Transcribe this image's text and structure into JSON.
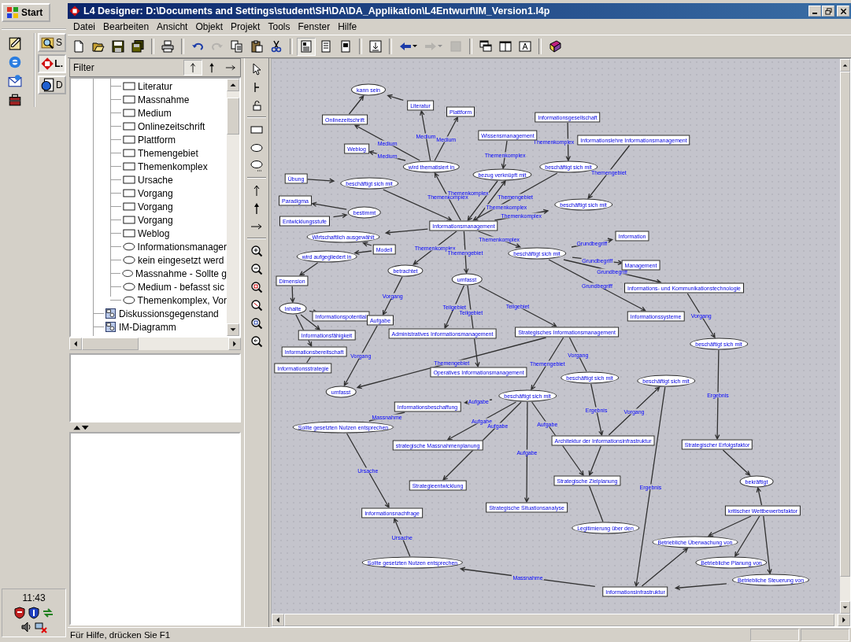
{
  "taskbar": {
    "start": "Start",
    "tasks": [
      {
        "label": "S",
        "selected": false
      },
      {
        "label": "L.",
        "selected": true
      },
      {
        "label": "D",
        "selected": false
      }
    ],
    "clock": "11:43"
  },
  "window": {
    "title": "L4 Designer: D:\\Documents and Settings\\student\\SH\\DA\\DA_Applikation\\L4Entwurf\\IM_Version1.l4p"
  },
  "menu": [
    "Datei",
    "Bearbeiten",
    "Ansicht",
    "Objekt",
    "Projekt",
    "Tools",
    "Fenster",
    "Hilfe"
  ],
  "toolbar": [
    {
      "pressed": false,
      "disabled": false
    },
    {
      "pressed": false,
      "disabled": false
    },
    {
      "pressed": false,
      "disabled": false
    },
    {
      "pressed": false,
      "disabled": false
    },
    {
      "pressed": false,
      "disabled": false
    },
    {
      "pressed": false,
      "disabled": false
    },
    {
      "pressed": false,
      "disabled": true
    },
    {
      "pressed": false,
      "disabled": false
    },
    {
      "pressed": false,
      "disabled": false
    },
    {
      "pressed": false,
      "disabled": false
    },
    {
      "pressed": true,
      "disabled": false
    },
    {
      "pressed": false,
      "disabled": false
    },
    {
      "pressed": false,
      "disabled": false
    },
    {
      "pressed": false,
      "disabled": false
    },
    {
      "pressed": false,
      "disabled": false
    },
    {
      "pressed": false,
      "disabled": true
    },
    {
      "pressed": false,
      "disabled": true
    },
    {
      "pressed": false,
      "disabled": false
    },
    {
      "pressed": false,
      "disabled": false
    },
    {
      "pressed": false,
      "disabled": false
    },
    {
      "pressed": false,
      "disabled": false
    }
  ],
  "filter": {
    "label": "Filter",
    "buttons": [
      {
        "selected": true
      },
      {
        "selected": false
      },
      {
        "selected": false
      }
    ]
  },
  "tree": {
    "elements": [
      {
        "kind": "rect",
        "label": "Literatur"
      },
      {
        "kind": "rect",
        "label": "Massnahme"
      },
      {
        "kind": "rect",
        "label": "Medium"
      },
      {
        "kind": "rect",
        "label": "Onlinezeitschrift"
      },
      {
        "kind": "rect",
        "label": "Plattform"
      },
      {
        "kind": "rect",
        "label": "Themengebiet"
      },
      {
        "kind": "rect",
        "label": "Themenkomplex"
      },
      {
        "kind": "rect",
        "label": "Ursache"
      },
      {
        "kind": "rect",
        "label": "Vorgang"
      },
      {
        "kind": "rect",
        "label": "Vorgang"
      },
      {
        "kind": "rect",
        "label": "Vorgang"
      },
      {
        "kind": "rect",
        "label": "Weblog"
      },
      {
        "kind": "ellipse",
        "label": "Informationsmanager"
      },
      {
        "kind": "ellipse",
        "label": "kein eingesetzt werd"
      },
      {
        "kind": "ellipse",
        "label": "Massnahme - Sollte g"
      },
      {
        "kind": "ellipse",
        "label": "Medium - befasst sic"
      },
      {
        "kind": "ellipse",
        "label": "Themenkomplex, Vor"
      }
    ],
    "diagrams": [
      "Diskussionsgegenstand",
      "IM-Diagramm"
    ]
  },
  "diagram": {
    "nodes": [
      {
        "kind": "ellipse",
        "label": "kann sein"
      },
      {
        "kind": "rect",
        "label": "Onlinezeitschrift"
      },
      {
        "kind": "rect",
        "label": "Literatur"
      },
      {
        "kind": "rect",
        "label": "Plattform"
      },
      {
        "kind": "rect",
        "label": "Weblog"
      },
      {
        "kind": "ellipse",
        "label": "wird thematisiert in"
      },
      {
        "kind": "rect",
        "label": "Wissensmanagement"
      },
      {
        "kind": "ellipse",
        "label": "bezug verknüpft mit"
      },
      {
        "kind": "rect",
        "label": "Informationsgesellschaft"
      },
      {
        "kind": "rect",
        "label": "Informationslehre Informationsmanagement"
      },
      {
        "kind": "ellipse",
        "label": "beschäftigt sich mit"
      },
      {
        "kind": "ellipse",
        "label": "beschäftigt sich mit"
      },
      {
        "kind": "rect",
        "label": "Übung"
      },
      {
        "kind": "ellipse",
        "label": "beschäftigt sich mit"
      },
      {
        "kind": "rect",
        "label": "Paradigma"
      },
      {
        "kind": "rect",
        "label": "Entwicklungsstufe"
      },
      {
        "kind": "ellipse",
        "label": "bestimmt"
      },
      {
        "kind": "rect",
        "label": "Informationsmanagement"
      },
      {
        "kind": "ellipse",
        "label": "Wirtschaftlich ausgewählt"
      },
      {
        "kind": "ellipse",
        "label": "wird aufgegliedert in"
      },
      {
        "kind": "rect",
        "label": "Modell"
      },
      {
        "kind": "ellipse",
        "label": "betrachtet"
      },
      {
        "kind": "ellipse",
        "label": "umfasst"
      },
      {
        "kind": "ellipse",
        "label": "beschäftigt sich mit"
      },
      {
        "kind": "rect",
        "label": "Information"
      },
      {
        "kind": "rect",
        "label": "Management"
      },
      {
        "kind": "rect",
        "label": "Informations- und Kommunikationstechnologie"
      },
      {
        "kind": "rect",
        "label": "Informationssysteme"
      },
      {
        "kind": "rect",
        "label": "Dimension"
      },
      {
        "kind": "ellipse",
        "label": "Inhalte"
      },
      {
        "kind": "rect",
        "label": "Informationspotential"
      },
      {
        "kind": "rect",
        "label": "Informationsfähigkeit"
      },
      {
        "kind": "rect",
        "label": "Informationsbereitschaft"
      },
      {
        "kind": "rect",
        "label": "Informationsstrategie"
      },
      {
        "kind": "rect",
        "label": "Aufgabe"
      },
      {
        "kind": "rect",
        "label": "Administratives Informationsmanagement"
      },
      {
        "kind": "rect",
        "label": "Strategisches Informationsmanagement"
      },
      {
        "kind": "rect",
        "label": "Operatives Informationsmanagement"
      },
      {
        "kind": "ellipse",
        "label": "umfasst"
      },
      {
        "kind": "rect",
        "label": "Informationsbeschaffung"
      },
      {
        "kind": "ellipse",
        "label": "beschäftigt sich mit"
      },
      {
        "kind": "ellipse",
        "label": "Sollte gesetzten Nutzen entsprechen"
      },
      {
        "kind": "rect",
        "label": "strategische Massnahmenplanung"
      },
      {
        "kind": "rect",
        "label": "Strategieentwicklung"
      },
      {
        "kind": "rect",
        "label": "Strategische Situationsanalyse"
      },
      {
        "kind": "ellipse",
        "label": "beschäftigt sich mit"
      },
      {
        "kind": "ellipse",
        "label": "beschäftigt sich mit"
      },
      {
        "kind": "rect",
        "label": "Architektur der Informationsinfrastruktur"
      },
      {
        "kind": "rect",
        "label": "Strategische Zielplanung"
      },
      {
        "kind": "ellipse",
        "label": "Legitimierung über den"
      },
      {
        "kind": "rect",
        "label": "Informationsinfrastruktur"
      },
      {
        "kind": "rect",
        "label": "Informationsnachfrage"
      },
      {
        "kind": "ellipse",
        "label": "Sollte gesetzten Nutzen entsprechen"
      },
      {
        "kind": "ellipse",
        "label": "beschäftigt sich mit"
      },
      {
        "kind": "rect",
        "label": "Strategischer Erfolgsfaktor"
      },
      {
        "kind": "ellipse",
        "label": "bekräftigt"
      },
      {
        "kind": "rect",
        "label": "kritischer Wettbewerbsfaktor"
      },
      {
        "kind": "ellipse",
        "label": "Betriebliche Überwachung von"
      },
      {
        "kind": "ellipse",
        "label": "Betriebliche Planung von"
      },
      {
        "kind": "ellipse",
        "label": "Betriebliche Steuerung von"
      }
    ],
    "edges": [
      {
        "arrow": true
      },
      {
        "arrow": true
      },
      {
        "arrow": true,
        "label": "Medium"
      },
      {
        "arrow": true,
        "label": "Medium"
      },
      {
        "arrow": true,
        "label": "Medium"
      },
      {
        "arrow": true,
        "label": "Medium"
      },
      {
        "arrow": true,
        "label": "Themenkomplex"
      },
      {
        "arrow": true,
        "label": "Themenkomplex"
      },
      {
        "arrow": true,
        "label": "Themenkomplex"
      },
      {
        "arrow": true,
        "label": "Themenkomplex"
      },
      {
        "arrow": true,
        "label": "Themenkomplex"
      },
      {
        "arrow": true,
        "label": "Themengebiet"
      },
      {
        "arrow": true,
        "label": "Themenkomplex"
      },
      {
        "arrow": true,
        "label": "Themengebiet"
      },
      {
        "arrow": true
      },
      {
        "arrow": true
      },
      {
        "arrow": true
      },
      {
        "arrow": true
      },
      {
        "arrow": true
      },
      {
        "arrow": true
      },
      {
        "arrow": true
      },
      {
        "arrow": true,
        "label": "Themenkomplex"
      },
      {
        "arrow": true,
        "label": "Themengebiet"
      },
      {
        "arrow": true,
        "label": "Themenkomplex"
      },
      {
        "arrow": true,
        "label": "Grundbegriff"
      },
      {
        "arrow": true,
        "label": "Grundbegriff"
      },
      {
        "arrow": true,
        "label": "Grundbegriff"
      },
      {
        "arrow": true,
        "label": "Grundbegriff"
      },
      {
        "arrow": true
      },
      {
        "arrow": true
      },
      {
        "arrow": true
      },
      {
        "arrow": true
      },
      {
        "arrow": true
      },
      {
        "arrow": false
      },
      {
        "arrow": true,
        "label": "Vorgang"
      },
      {
        "arrow": true,
        "label": "Teilgebiet"
      },
      {
        "arrow": true,
        "label": "Teilgebiet"
      },
      {
        "arrow": true,
        "label": "Teilgebiet"
      },
      {
        "arrow": true,
        "label": "Vorgang"
      },
      {
        "arrow": true,
        "label": "Themengebiet"
      },
      {
        "arrow": true,
        "label": "Themengebiet"
      },
      {
        "arrow": false,
        "label": "Vorgang"
      },
      {
        "arrow": true,
        "label": "Aufgabe"
      },
      {
        "arrow": false,
        "label": "Massnahme"
      },
      {
        "arrow": true,
        "label": "Aufgabe"
      },
      {
        "arrow": true,
        "label": "Aufgabe"
      },
      {
        "arrow": true,
        "label": "Aufgabe"
      },
      {
        "arrow": true,
        "label": "Aufgabe"
      },
      {
        "arrow": true,
        "label": "Ergebnis"
      },
      {
        "arrow": true,
        "label": "Vorgang"
      },
      {
        "arrow": true
      },
      {
        "arrow": false
      },
      {
        "arrow": true,
        "label": "Ergebnis"
      },
      {
        "arrow": true,
        "label": "Ursache"
      },
      {
        "arrow": true,
        "label": "Ursache"
      },
      {
        "arrow": true,
        "label": "Massnahme"
      },
      {
        "arrow": true,
        "label": "Vorgang"
      },
      {
        "arrow": true,
        "label": "Ergebnis"
      },
      {
        "arrow": true
      },
      {
        "arrow": true
      },
      {
        "arrow": true
      },
      {
        "arrow": true
      },
      {
        "arrow": true
      },
      {
        "arrow": true
      },
      {
        "arrow": true
      }
    ]
  },
  "status_bar": "Für Hilfe, drücken Sie F1"
}
